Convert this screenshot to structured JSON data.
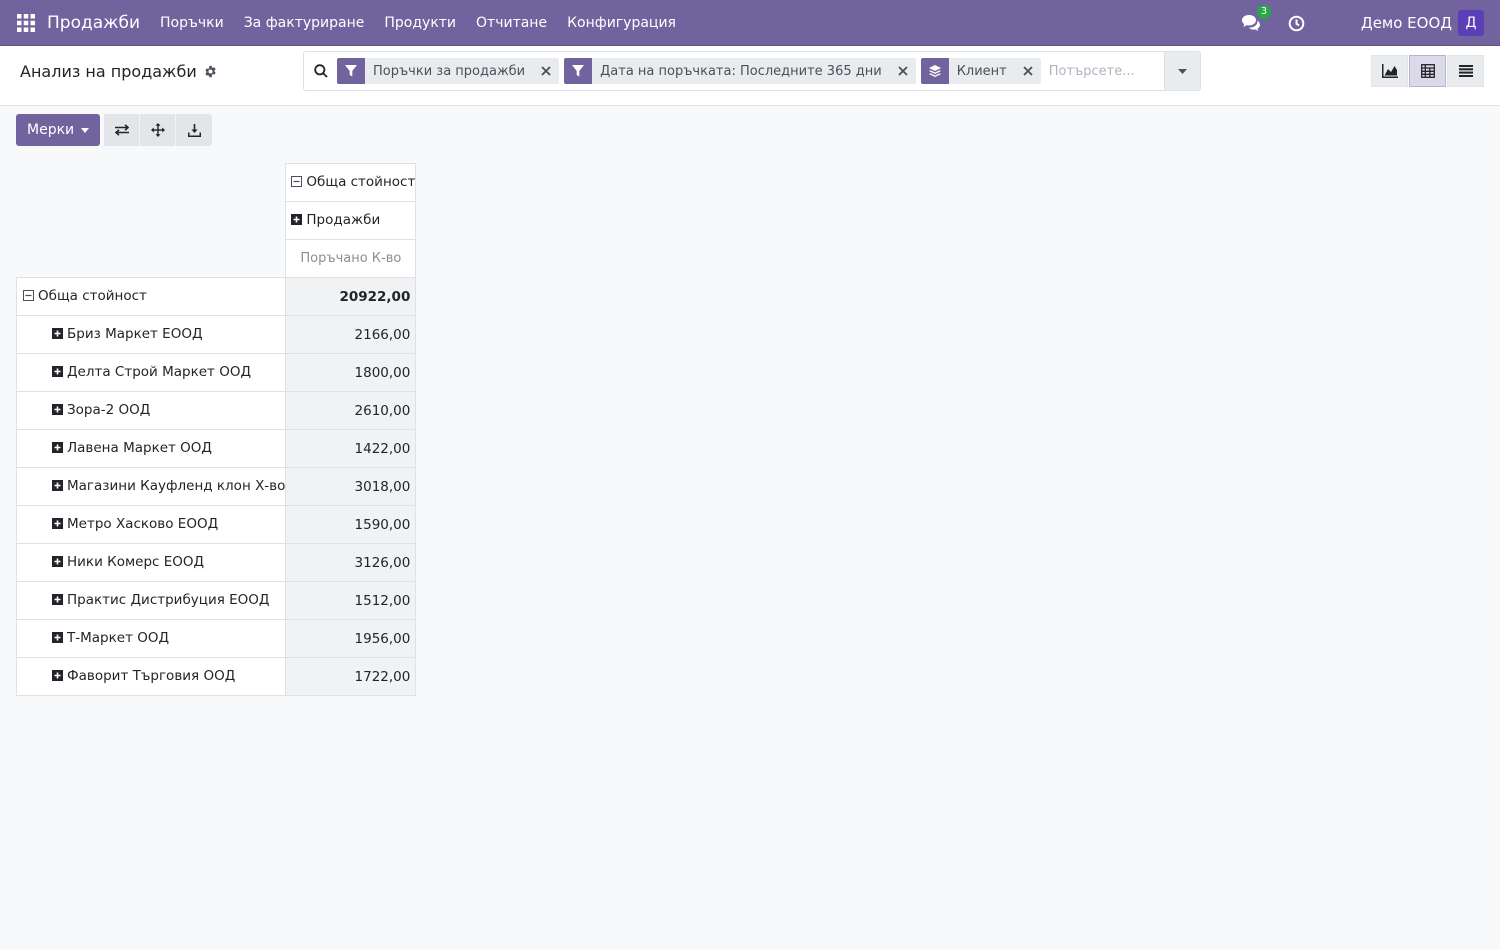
{
  "navbar": {
    "app_name": "Продажби",
    "menu": [
      "Поръчки",
      "За фактуриране",
      "Продукти",
      "Отчитане",
      "Конфигурация"
    ],
    "messages_count": "3",
    "company": "Демо ЕООД",
    "avatar_letter": "Д",
    "color": "#71639e"
  },
  "control_panel": {
    "breadcrumb": "Анализ на продажби",
    "search": {
      "facets": [
        {
          "icon": "filter-icon",
          "label": "Поръчки за продажби"
        },
        {
          "icon": "filter-icon",
          "label": "Дата на поръчката: Последните 365 дни"
        },
        {
          "icon": "group-by-icon",
          "label": "Клиент"
        }
      ],
      "placeholder": "Потърсете..."
    },
    "views": [
      "graph-view-icon",
      "pivot-view-icon",
      "list-view-icon"
    ],
    "active_view": "pivot-view-icon"
  },
  "toolbar": {
    "measures_label": "Мерки",
    "buttons": [
      "flip-axis-icon",
      "expand-all-icon",
      "download-icon"
    ]
  },
  "pivot": {
    "column_header": "Обща стойност",
    "column_subheader": "Продажби",
    "measure": "Поръчано К-во",
    "total_label": "Обща стойност",
    "total_value": "20922,00",
    "rows": [
      {
        "label": "Бриз Маркет ЕООД",
        "value": "2166,00"
      },
      {
        "label": "Делта Строй Маркет ООД",
        "value": "1800,00"
      },
      {
        "label": "Зора-2 ООД",
        "value": "2610,00"
      },
      {
        "label": "Лавена Маркет ООД",
        "value": "1422,00"
      },
      {
        "label": "Магазини Кауфленд клон Х-во",
        "value": "3018,00"
      },
      {
        "label": "Метро Хасково ЕООД",
        "value": "1590,00"
      },
      {
        "label": "Ники Комерс ЕООД",
        "value": "3126,00"
      },
      {
        "label": "Практис Дистрибуция ЕООД",
        "value": "1512,00"
      },
      {
        "label": "Т-Маркет ООД",
        "value": "1956,00"
      },
      {
        "label": "Фаворит Търговия ООД",
        "value": "1722,00"
      }
    ]
  }
}
